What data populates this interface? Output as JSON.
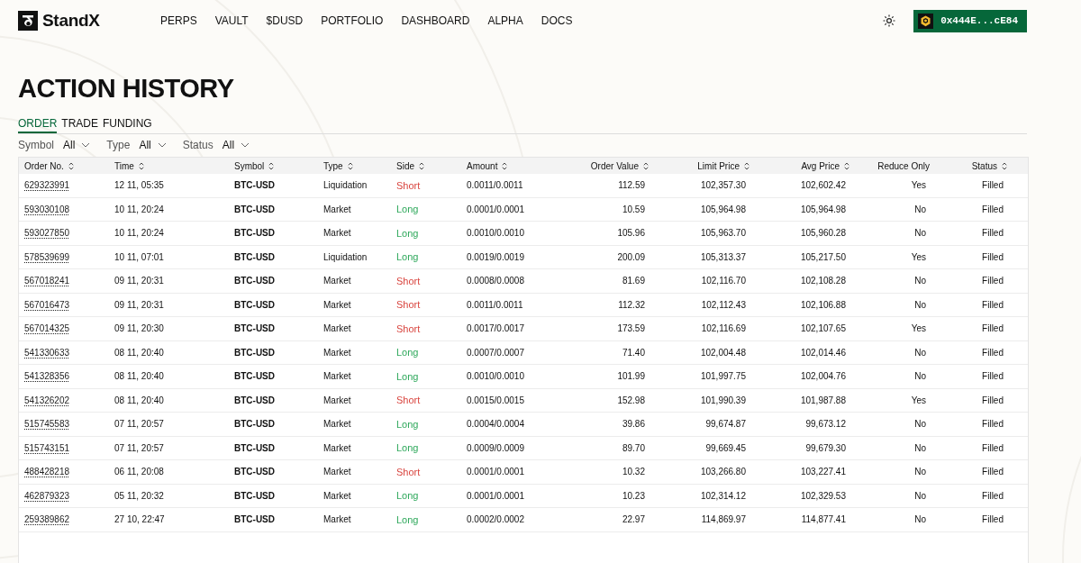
{
  "brand": {
    "name": "StandX"
  },
  "nav": [
    "PERPS",
    "VAULT",
    "$DUSD",
    "PORTFOLIO",
    "DASHBOARD",
    "ALPHA",
    "DOCS"
  ],
  "wallet": {
    "address": "0x444E...cE84"
  },
  "page_title": "ACTION HISTORY",
  "tabs": [
    {
      "label": "ORDER",
      "selected": true
    },
    {
      "label": "TRADE",
      "selected": false
    },
    {
      "label": "FUNDING",
      "selected": false
    }
  ],
  "filters": [
    {
      "label": "Symbol",
      "value": "All"
    },
    {
      "label": "Type",
      "value": "All"
    },
    {
      "label": "Status",
      "value": "All"
    }
  ],
  "table": {
    "columns": [
      {
        "label": "Order No.",
        "sortable": true
      },
      {
        "label": "Time",
        "sortable": true
      },
      {
        "label": "Symbol",
        "sortable": true
      },
      {
        "label": "Type",
        "sortable": true
      },
      {
        "label": "Side",
        "sortable": true
      },
      {
        "label": "Amount",
        "sortable": true
      },
      {
        "label": "Order Value",
        "sortable": true
      },
      {
        "label": "Limit Price",
        "sortable": true
      },
      {
        "label": "Avg Price",
        "sortable": true
      },
      {
        "label": "Reduce Only",
        "sortable": false
      },
      {
        "label": "Status",
        "sortable": true
      }
    ],
    "rows": [
      {
        "order_no": "629323991",
        "time": "12 11, 05:35",
        "symbol": "BTC-USD",
        "type": "Liquidation",
        "side": {
          "label": "Short",
          "color": "#d9453f"
        },
        "amount": "0.0011/0.0011",
        "order_value": "112.59",
        "limit_price": "102,357.30",
        "avg_price": "102,602.42",
        "reduce_only": "Yes",
        "status": "Filled"
      },
      {
        "order_no": "593030108",
        "time": "10 11, 20:24",
        "symbol": "BTC-USD",
        "type": "Market",
        "side": {
          "label": "Long",
          "color": "#2ea85b"
        },
        "amount": "0.0001/0.0001",
        "order_value": "10.59",
        "limit_price": "105,964.98",
        "avg_price": "105,964.98",
        "reduce_only": "No",
        "status": "Filled"
      },
      {
        "order_no": "593027850",
        "time": "10 11, 20:24",
        "symbol": "BTC-USD",
        "type": "Market",
        "side": {
          "label": "Long",
          "color": "#2ea85b"
        },
        "amount": "0.0010/0.0010",
        "order_value": "105.96",
        "limit_price": "105,963.70",
        "avg_price": "105,960.28",
        "reduce_only": "No",
        "status": "Filled"
      },
      {
        "order_no": "578539699",
        "time": "10 11, 07:01",
        "symbol": "BTC-USD",
        "type": "Liquidation",
        "side": {
          "label": "Long",
          "color": "#2ea85b"
        },
        "amount": "0.0019/0.0019",
        "order_value": "200.09",
        "limit_price": "105,313.37",
        "avg_price": "105,217.50",
        "reduce_only": "Yes",
        "status": "Filled"
      },
      {
        "order_no": "567018241",
        "time": "09 11, 20:31",
        "symbol": "BTC-USD",
        "type": "Market",
        "side": {
          "label": "Short",
          "color": "#d9453f"
        },
        "amount": "0.0008/0.0008",
        "order_value": "81.69",
        "limit_price": "102,116.70",
        "avg_price": "102,108.28",
        "reduce_only": "No",
        "status": "Filled"
      },
      {
        "order_no": "567016473",
        "time": "09 11, 20:31",
        "symbol": "BTC-USD",
        "type": "Market",
        "side": {
          "label": "Short",
          "color": "#d9453f"
        },
        "amount": "0.0011/0.0011",
        "order_value": "112.32",
        "limit_price": "102,112.43",
        "avg_price": "102,106.88",
        "reduce_only": "No",
        "status": "Filled"
      },
      {
        "order_no": "567014325",
        "time": "09 11, 20:30",
        "symbol": "BTC-USD",
        "type": "Market",
        "side": {
          "label": "Short",
          "color": "#d9453f"
        },
        "amount": "0.0017/0.0017",
        "order_value": "173.59",
        "limit_price": "102,116.69",
        "avg_price": "102,107.65",
        "reduce_only": "Yes",
        "status": "Filled"
      },
      {
        "order_no": "541330633",
        "time": "08 11, 20:40",
        "symbol": "BTC-USD",
        "type": "Market",
        "side": {
          "label": "Long",
          "color": "#2ea85b"
        },
        "amount": "0.0007/0.0007",
        "order_value": "71.40",
        "limit_price": "102,004.48",
        "avg_price": "102,014.46",
        "reduce_only": "No",
        "status": "Filled"
      },
      {
        "order_no": "541328356",
        "time": "08 11, 20:40",
        "symbol": "BTC-USD",
        "type": "Market",
        "side": {
          "label": "Long",
          "color": "#2ea85b"
        },
        "amount": "0.0010/0.0010",
        "order_value": "101.99",
        "limit_price": "101,997.75",
        "avg_price": "102,004.76",
        "reduce_only": "No",
        "status": "Filled"
      },
      {
        "order_no": "541326202",
        "time": "08 11, 20:40",
        "symbol": "BTC-USD",
        "type": "Market",
        "side": {
          "label": "Short",
          "color": "#d9453f"
        },
        "amount": "0.0015/0.0015",
        "order_value": "152.98",
        "limit_price": "101,990.39",
        "avg_price": "101,987.88",
        "reduce_only": "Yes",
        "status": "Filled"
      },
      {
        "order_no": "515745583",
        "time": "07 11, 20:57",
        "symbol": "BTC-USD",
        "type": "Market",
        "side": {
          "label": "Long",
          "color": "#2ea85b"
        },
        "amount": "0.0004/0.0004",
        "order_value": "39.86",
        "limit_price": "99,674.87",
        "avg_price": "99,673.12",
        "reduce_only": "No",
        "status": "Filled"
      },
      {
        "order_no": "515743151",
        "time": "07 11, 20:57",
        "symbol": "BTC-USD",
        "type": "Market",
        "side": {
          "label": "Long",
          "color": "#2ea85b"
        },
        "amount": "0.0009/0.0009",
        "order_value": "89.70",
        "limit_price": "99,669.45",
        "avg_price": "99,679.30",
        "reduce_only": "No",
        "status": "Filled"
      },
      {
        "order_no": "488428218",
        "time": "06 11, 20:08",
        "symbol": "BTC-USD",
        "type": "Market",
        "side": {
          "label": "Short",
          "color": "#d9453f"
        },
        "amount": "0.0001/0.0001",
        "order_value": "10.32",
        "limit_price": "103,266.80",
        "avg_price": "103,227.41",
        "reduce_only": "No",
        "status": "Filled"
      },
      {
        "order_no": "462879323",
        "time": "05 11, 20:32",
        "symbol": "BTC-USD",
        "type": "Market",
        "side": {
          "label": "Long",
          "color": "#2ea85b"
        },
        "amount": "0.0001/0.0001",
        "order_value": "10.23",
        "limit_price": "102,314.12",
        "avg_price": "102,329.53",
        "reduce_only": "No",
        "status": "Filled"
      },
      {
        "order_no": "259389862",
        "time": "27 10, 22:47",
        "symbol": "BTC-USD",
        "type": "Market",
        "side": {
          "label": "Long",
          "color": "#2ea85b"
        },
        "amount": "0.0002/0.0002",
        "order_value": "22.97",
        "limit_price": "114,869.97",
        "avg_price": "114,877.41",
        "reduce_only": "No",
        "status": "Filled"
      }
    ]
  }
}
